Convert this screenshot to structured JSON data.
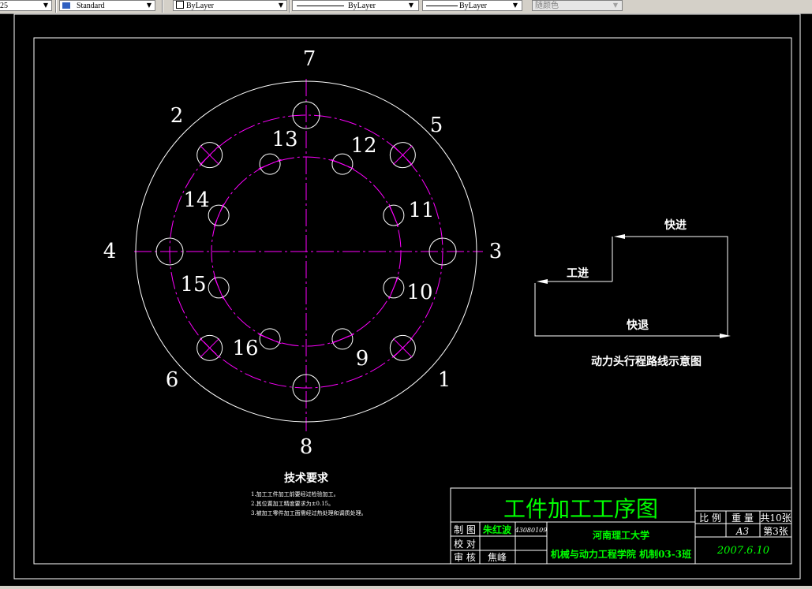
{
  "toolbar": {
    "style_partial": "25",
    "text_style": "Standard",
    "layer_color": "ByLayer",
    "linetype": "ByLayer",
    "lineweight": "ByLayer",
    "plot_style": "随颜色"
  },
  "drawing": {
    "hole_numbers": [
      "1",
      "2",
      "3",
      "4",
      "5",
      "6",
      "7",
      "8",
      "9",
      "10",
      "11",
      "12",
      "13",
      "14",
      "15",
      "16"
    ],
    "route": {
      "fast_forward": "快进",
      "work_feed": "工进",
      "fast_return": "快退",
      "caption": "动力头行程路线示意图"
    },
    "tech_req": {
      "title": "技术要求",
      "items": [
        "1.加工工件加工前要经过检验加工。",
        "2.其位置加工精度要求为±0.15。",
        "3.被加工零件加工面需经过热处理和调质处理。"
      ]
    },
    "title_block": {
      "title": "工件加工工序图",
      "drawn_label": "制 图",
      "drawn_name": "朱红波",
      "drawn_id": "43080109",
      "check_label": "校 对",
      "review_label": "审 核",
      "review_name": "焦峰",
      "university": "河南理工大学",
      "college": "机械与动力工程学院 机制03-3班",
      "scale_label": "比 例",
      "weight_label": "重 量",
      "sheets_total": "共10张",
      "sheet_no": "第3张",
      "format": "A3",
      "date": "2007.6.10"
    }
  },
  "colors": {
    "white": "#ffffff",
    "magenta": "#ff00ff",
    "green": "#00ff00",
    "black": "#000000"
  }
}
